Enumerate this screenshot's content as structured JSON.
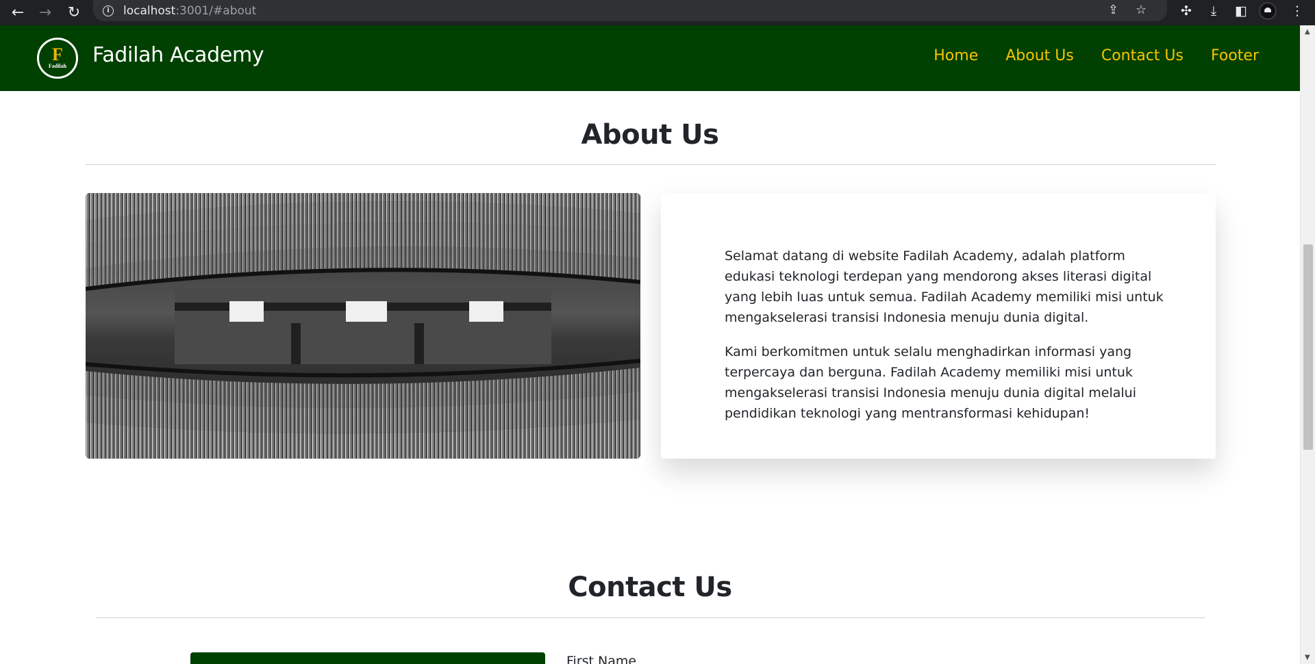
{
  "browser": {
    "url_host": "localhost",
    "url_path": ":3001/#about"
  },
  "navbar": {
    "brand": "Fadilah Academy",
    "logo_letter": "F",
    "logo_text": "Fadilah",
    "links": [
      "Home",
      "About Us",
      "Contact Us",
      "Footer"
    ]
  },
  "about": {
    "title": "About Us",
    "paragraphs": [
      "Selamat datang di website Fadilah Academy, adalah platform edukasi teknologi terdepan yang mendorong akses literasi digital yang lebih luas untuk semua. Fadilah Academy memiliki misi untuk mengakselerasi transisi Indonesia menuju dunia digital.",
      "Kami berkomitmen untuk selalu menghadirkan informasi yang terpercaya dan berguna. Fadilah Academy memiliki misi untuk mengakselerasi transisi Indonesia menuju dunia digital melalui pendidikan teknologi yang mentransformasi kehidupan!"
    ]
  },
  "contact": {
    "title": "Contact Us",
    "first_name_label": "First Name"
  },
  "colors": {
    "navbar_bg": "#004000",
    "nav_link": "#f7c400",
    "brand_text": "#ffffff"
  }
}
